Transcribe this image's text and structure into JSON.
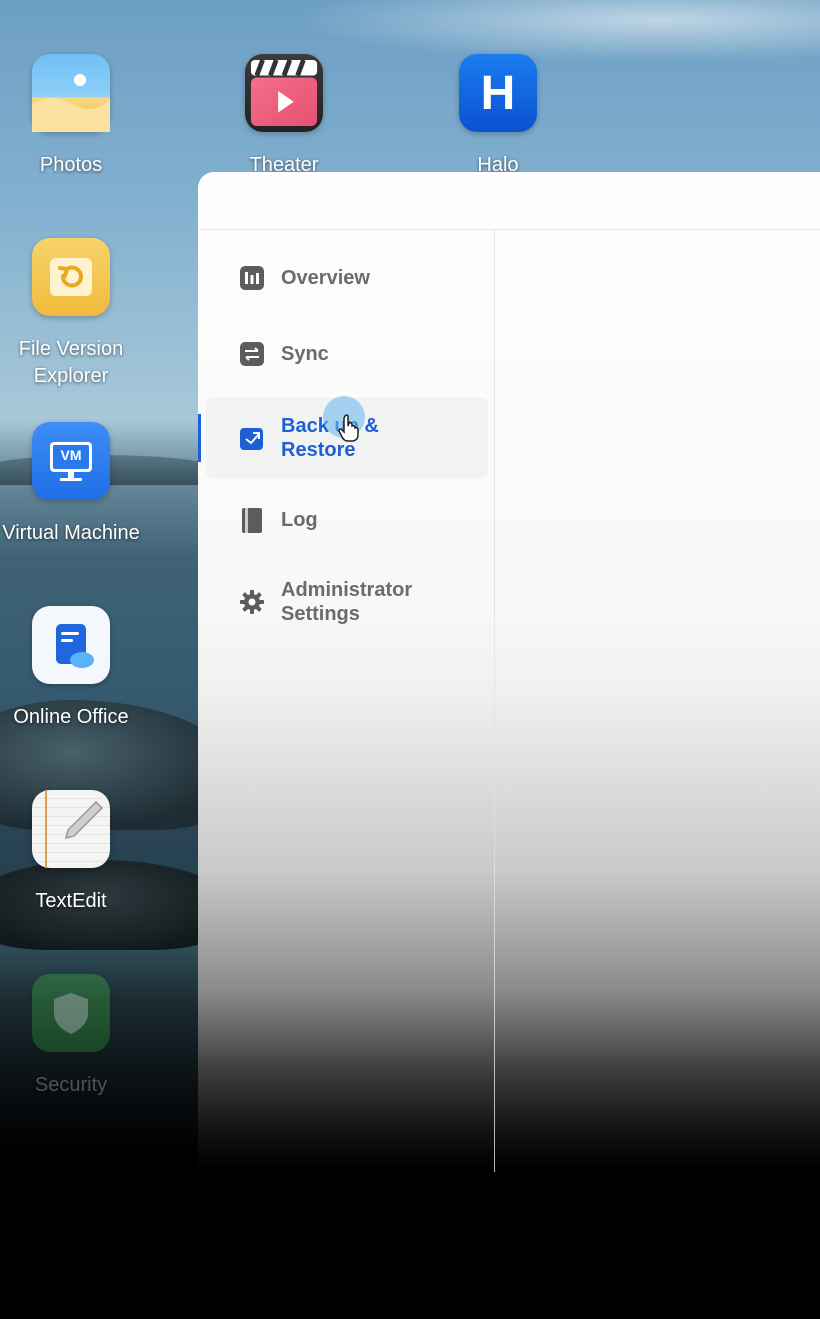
{
  "desktop": {
    "icons": [
      {
        "label": "Photos",
        "icon": "photos-icon"
      },
      {
        "label": "Theater",
        "icon": "theater-icon"
      },
      {
        "label": "Halo",
        "icon": "halo-icon",
        "glyph": "H"
      },
      {
        "label": "File Version\nExplorer",
        "icon": "file-version-explorer-icon"
      },
      {
        "label": "Virtual Machine",
        "icon": "virtual-machine-icon",
        "glyph": "VM"
      },
      {
        "label": "Online Office",
        "icon": "online-office-icon"
      },
      {
        "label": "TextEdit",
        "icon": "textedit-icon"
      },
      {
        "label": "Security",
        "icon": "security-icon"
      }
    ]
  },
  "window": {
    "nav": [
      {
        "label": "Overview",
        "icon": "overview-icon",
        "active": false
      },
      {
        "label": "Sync",
        "icon": "sync-icon",
        "active": false
      },
      {
        "label": "Back up &\nRestore",
        "icon": "backup-restore-icon",
        "active": true
      },
      {
        "label": "Log",
        "icon": "log-icon",
        "active": false
      },
      {
        "label": "Administrator\nSettings",
        "icon": "gear-icon",
        "active": false
      }
    ]
  },
  "colors": {
    "accent": "#1f5fd6",
    "nav_text": "#6b6b6b"
  }
}
